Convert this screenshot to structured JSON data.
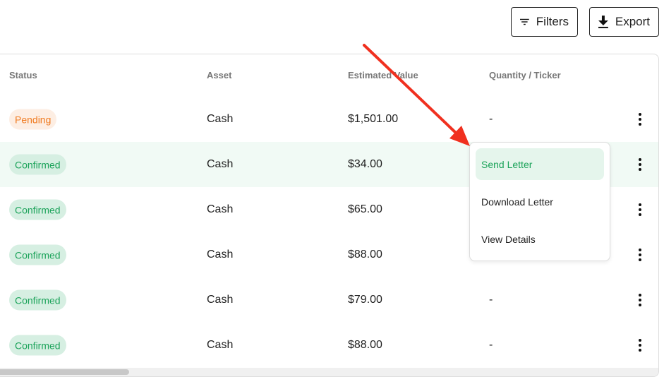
{
  "toolbar": {
    "filters_label": "Filters",
    "export_label": "Export",
    "filters_icon": "filter-icon",
    "export_icon": "download-icon"
  },
  "table": {
    "columns": [
      "Status",
      "Asset",
      "Estimated Value",
      "Quantity / Ticker"
    ],
    "rows": [
      {
        "status": "Pending",
        "asset": "Cash",
        "value": "$1,501.00",
        "qty": "-"
      },
      {
        "status": "Confirmed",
        "asset": "Cash",
        "value": "$34.00",
        "qty": ""
      },
      {
        "status": "Confirmed",
        "asset": "Cash",
        "value": "$65.00",
        "qty": ""
      },
      {
        "status": "Confirmed",
        "asset": "Cash",
        "value": "$88.00",
        "qty": ""
      },
      {
        "status": "Confirmed",
        "asset": "Cash",
        "value": "$79.00",
        "qty": "-"
      },
      {
        "status": "Confirmed",
        "asset": "Cash",
        "value": "$88.00",
        "qty": "-"
      }
    ]
  },
  "menu": {
    "items": [
      "Send Letter",
      "Download Letter",
      "View Details"
    ],
    "active": "Send Letter"
  },
  "colors": {
    "pending": "#f07b21",
    "confirmed": "#1ca35a",
    "annotation_arrow": "#f0301f"
  }
}
